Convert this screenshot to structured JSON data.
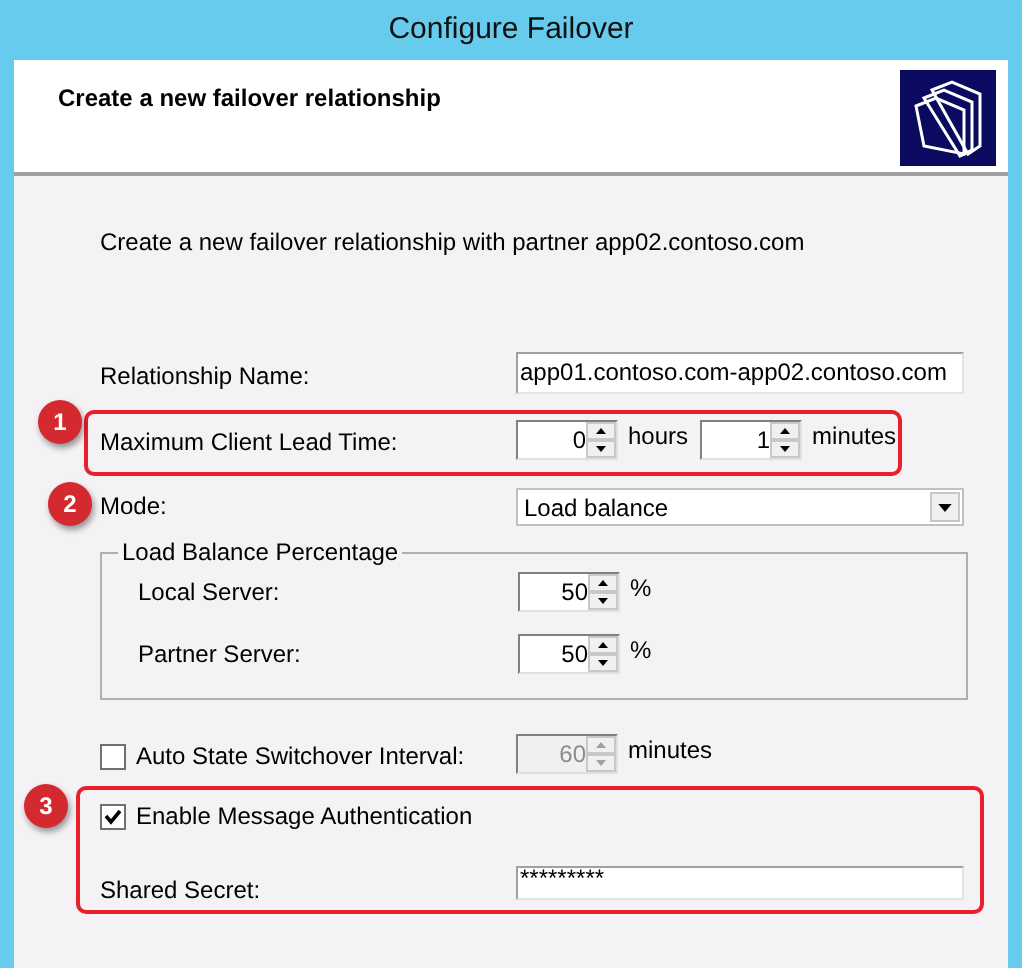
{
  "window": {
    "title": "Configure Failover"
  },
  "header": {
    "title": "Create a new failover relationship"
  },
  "intro": "Create a new failover relationship with partner app02.contoso.com",
  "rows": [
    {
      "kind": "text",
      "label": "Relationship Name:",
      "value": "app01.contoso.com-app02.contoso.com"
    },
    {
      "kind": "spinners",
      "label": "Maximum Client Lead Time:",
      "spinners": [
        {
          "value": "0",
          "unit": "hours",
          "disabled": false
        },
        {
          "value": "1",
          "unit": "minutes",
          "disabled": false
        }
      ]
    },
    {
      "kind": "dropdown",
      "label": "Mode:",
      "value": "Load balance"
    },
    {
      "kind": "group",
      "title": "Load Balance Percentage",
      "rows": [
        {
          "label": "Local Server:",
          "spinners": [
            {
              "value": "50",
              "unit": "%",
              "disabled": false
            }
          ]
        },
        {
          "label": "Partner Server:",
          "spinners": [
            {
              "value": "50",
              "unit": "%",
              "disabled": false
            }
          ]
        }
      ]
    },
    {
      "kind": "checkbox_spinner",
      "label": "Auto State Switchover Interval:",
      "checked": false,
      "spinners": [
        {
          "value": "60",
          "unit": "minutes",
          "disabled": true
        }
      ]
    },
    {
      "kind": "checkbox",
      "label": "Enable Message Authentication",
      "checked": true
    },
    {
      "kind": "password",
      "label": "Shared Secret:",
      "value": "*********"
    }
  ],
  "callouts": [
    {
      "number": "1"
    },
    {
      "number": "2"
    },
    {
      "number": "3"
    }
  ]
}
